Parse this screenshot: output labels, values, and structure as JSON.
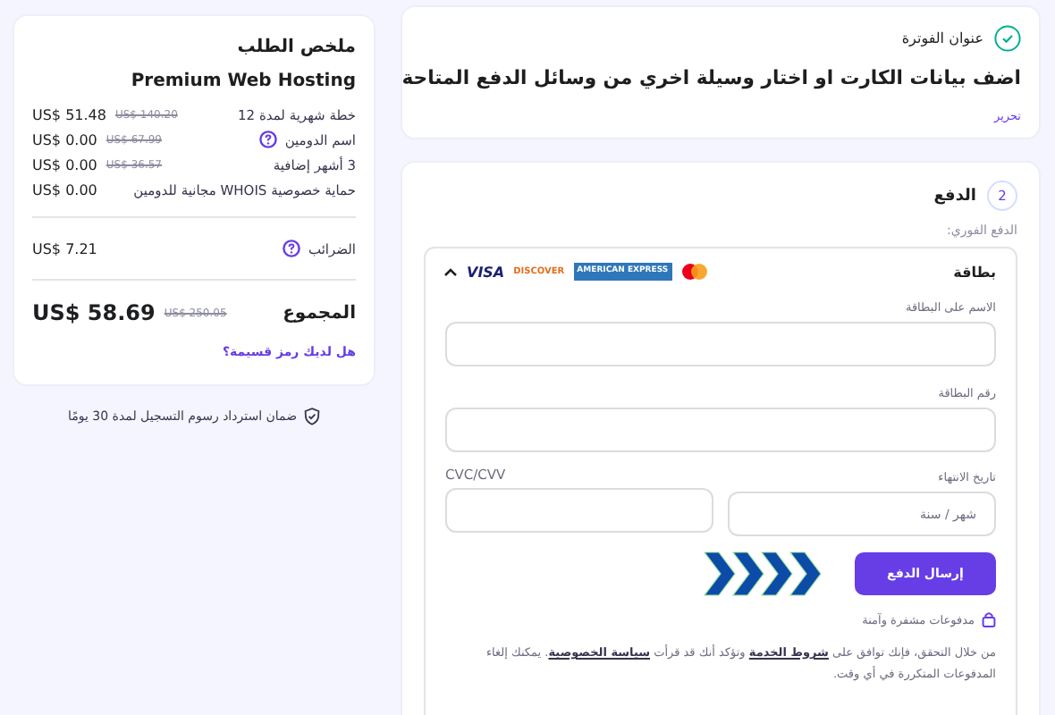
{
  "summary": {
    "title": "ملخص الطلب",
    "product": "Premium Web Hosting",
    "items": [
      {
        "label": "خطة شهرية لمدة 12",
        "price": "US$ 51.48",
        "old_price": "US$ 140.20",
        "help": false
      },
      {
        "label": "اسم الدومين",
        "price": "US$ 0.00",
        "old_price": "US$ 67.99",
        "help": true
      },
      {
        "label": "3 أشهر إضافية",
        "price": "US$ 0.00",
        "old_price": "US$ 36.57",
        "help": false
      },
      {
        "label": "حماية خصوصية WHOIS مجانية للدومين",
        "price": "US$ 0.00",
        "help": false
      }
    ],
    "tax": {
      "label": "الضرائب",
      "price": "US$ 7.21"
    },
    "total": {
      "label": "المجموع",
      "price": "US$ 58.69",
      "old_price": "US$ 250.05"
    },
    "coupon_link": "هل لديك رمز قسيمة؟"
  },
  "guarantee": "ضمان استرداد رسوم التسجيل لمدة 30 يومًا",
  "billing": {
    "title": "عنوان الفوترة",
    "message": "اضف بيانات الكارت او اختار وسيلة اخري من وسائل الدفع المتاحة",
    "edit_link": "تحرير"
  },
  "payment": {
    "step": "2",
    "title": "الدفع",
    "subtitle": "الدفع الفوري:",
    "method": {
      "label": "بطاقة",
      "expanded": true,
      "brands": [
        "AMERICAN EXPRESS",
        "DISCOVER",
        "VISA"
      ]
    },
    "fields": [
      {
        "label": "الاسم على البطاقة"
      },
      {
        "label": "رقم البطاقة"
      }
    ],
    "expiry": {
      "label": "تاريخ الانتهاء",
      "placeholder": "شهر / سنة"
    },
    "cvc": {
      "label": "CVC/CVV"
    },
    "submit": "إرسال الدفع",
    "secure_note": "مدفوعات مشفرة وآمنة",
    "terms": [
      {
        "kind": "text",
        "text": "من خلال التحقق، فإنك توافق على "
      },
      {
        "kind": "link",
        "text": "شروط الخدمة"
      },
      {
        "kind": "text",
        "text": " وتؤكد أنك قد قرأت "
      },
      {
        "kind": "link",
        "text": "سياسة الخصوصية"
      },
      {
        "kind": "text",
        "text": ". يمكنك إلغاء المدفوعات المتكررة في أي وقت."
      }
    ]
  }
}
